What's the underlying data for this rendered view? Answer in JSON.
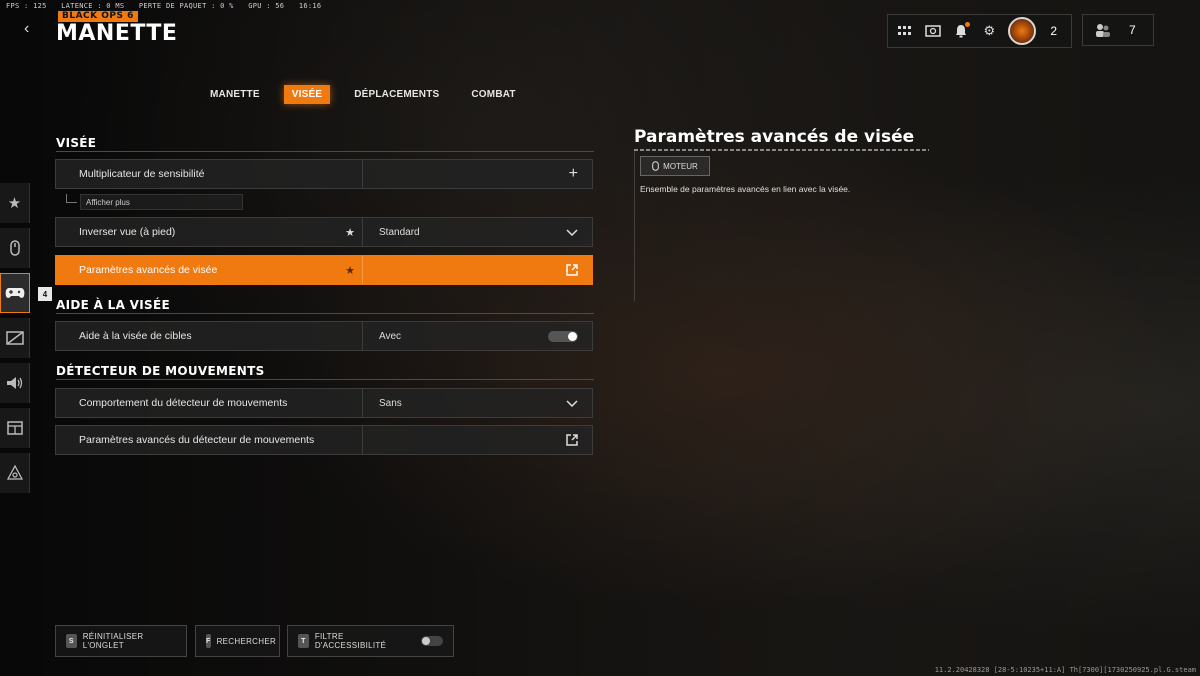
{
  "hud": {
    "fps": "FPS : 125",
    "latency": "LATENCE : 0 MS",
    "packet_loss": "PERTE DE PAQUET : 0 %",
    "gpu": "GPU : 56",
    "time": "16:16"
  },
  "header": {
    "logo": "BLACK OPS 6",
    "title": "MANETTE"
  },
  "topbar": {
    "profile_count": "2",
    "friends_count": "7",
    "icons": [
      "apps-grid-icon",
      "store-icon",
      "notification-bell-icon",
      "settings-gear-icon",
      "profile-avatar",
      "friends-icon"
    ]
  },
  "tabs": [
    {
      "label": "MANETTE",
      "active": false
    },
    {
      "label": "VISÉE",
      "active": true
    },
    {
      "label": "DÉPLACEMENTS",
      "active": false
    },
    {
      "label": "COMBAT",
      "active": false
    }
  ],
  "sidebar": {
    "items": [
      "star-icon",
      "mouse-icon",
      "controller-icon",
      "display-icon",
      "audio-icon",
      "interface-icon",
      "network-icon"
    ],
    "active_index": 2,
    "badge": "4"
  },
  "sections": {
    "visee": {
      "title": "VISÉE",
      "sensitivity_label": "Multiplicateur de sensibilité",
      "show_more": "Afficher plus",
      "invert_label": "Inverser vue (à pied)",
      "invert_value": "Standard",
      "advanced_label": "Paramètres avancés de visée"
    },
    "aide": {
      "title": "AIDE À LA VISÉE",
      "target_label": "Aide à la visée de cibles",
      "target_value": "Avec"
    },
    "detecteur": {
      "title": "DÉTECTEUR DE MOUVEMENTS",
      "behavior_label": "Comportement du détecteur de mouvements",
      "behavior_value": "Sans",
      "advanced_label": "Paramètres avancés du détecteur de mouvements"
    }
  },
  "detail": {
    "title": "Paramètres avancés de visée",
    "tag": "MOTEUR",
    "description": "Ensemble de paramètres avancés en lien avec la visée."
  },
  "bottom": {
    "reset": {
      "key": "S",
      "label": "RÉINITIALISER L'ONGLET"
    },
    "search": {
      "key": "F",
      "label": "RECHERCHER"
    },
    "filter": {
      "key": "T",
      "label": "FILTRE D'ACCESSIBILITÉ"
    }
  },
  "version": "11.2.20428328 [28-5:10235+11:A] Th[7300][1730250925.pl.G.steam"
}
